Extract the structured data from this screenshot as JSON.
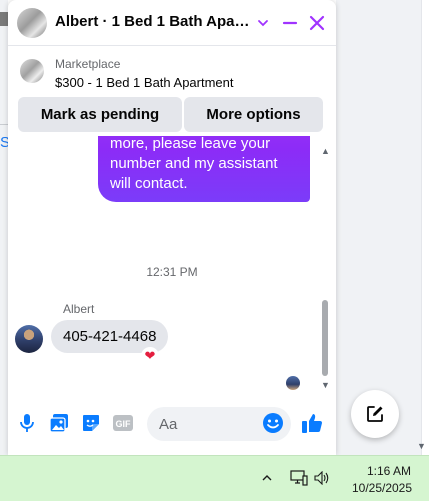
{
  "chat": {
    "title": "Albert · 1 Bed 1 Bath Apart...",
    "listing": {
      "source": "Marketplace",
      "title": "$300 - 1 Bed 1 Bath Apartment"
    },
    "actions": {
      "mark_pending": "Mark as pending",
      "more_options": "More options"
    },
    "messages": {
      "outgoing_text": "information about this property and want to know more, please leave your number and my assistant will contact.",
      "timestamp": "12:31 PM",
      "sender_name": "Albert",
      "incoming_text": "405-421-4468",
      "reaction": "❤"
    },
    "composer": {
      "placeholder": "Aa"
    },
    "colors": {
      "accent": "#a033ff",
      "bubble_gradient_top": "#a532f5",
      "bubble_gradient_bottom": "#7b3cf9",
      "like_blue": "#0a7cff"
    }
  },
  "background": {
    "left_link_letter": "S"
  },
  "taskbar": {
    "time": "1:16 AM",
    "date": "10/25/2025",
    "tray_icons": [
      "chevron-up-icon",
      "network-icon",
      "volume-icon"
    ],
    "color": "#d5f5d0"
  }
}
